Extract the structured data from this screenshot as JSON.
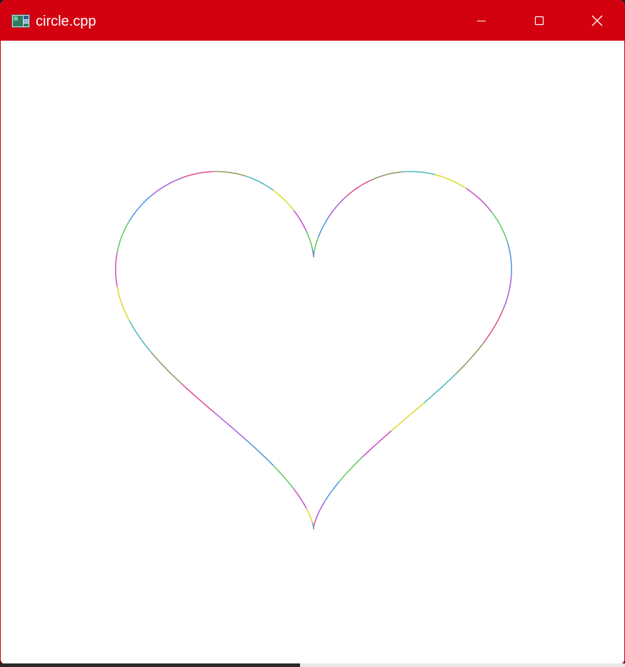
{
  "window": {
    "title": "circle.cpp",
    "accent_color": "#d3000f",
    "icons": {
      "app": "app-window-icon",
      "minimize": "minimize-icon",
      "maximize": "maximize-icon",
      "close": "close-icon"
    }
  },
  "drawing": {
    "shape": "heart outline",
    "background": "#ffffff",
    "stroke_colors": [
      "#cc55cc",
      "#66cc66",
      "#5599dd",
      "#aa66dd",
      "#dd5599",
      "#999966",
      "#55bbbb",
      "#dddd33"
    ]
  }
}
